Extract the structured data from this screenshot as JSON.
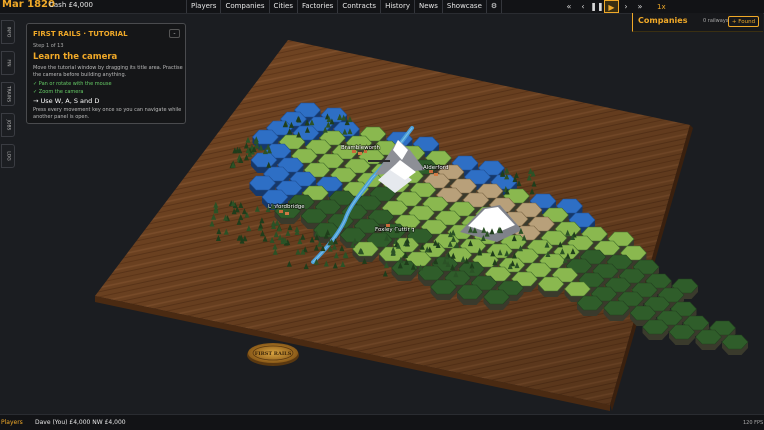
{
  "topbar": {
    "date": "Mar 1820",
    "cash": "Cash £4,000",
    "menu": [
      "Players",
      "Companies",
      "Cities",
      "Factories",
      "Contracts",
      "History",
      "News",
      "Showcase"
    ],
    "settings_icon": "gear-icon",
    "time_controls": [
      "rewind-fast-icon",
      "rewind-icon",
      "pause-icon",
      "play-icon",
      "forward-icon",
      "forward-fast-icon"
    ],
    "speed": "1x"
  },
  "companies_panel": {
    "title": "Companies",
    "subtitle": "0 railways",
    "found_button": "+ Found"
  },
  "side_tabs": [
    "INFO",
    "FIN",
    "TRAINS",
    "JOBS",
    "LOG"
  ],
  "tutorial": {
    "title": "FIRST RAILS · TUTORIAL",
    "minimize": "-",
    "step": "Step 1 of 13",
    "heading": "Learn the camera",
    "description": "Move the tutorial window by dragging its title area. Practise the camera before building anything.",
    "completed": [
      "✓ Pan or rotate with the mouse",
      "✓ Zoom the camera"
    ],
    "current": "→ Use W, A, S and D",
    "note": "Press every movement key once so you can navigate while another panel is open."
  },
  "map": {
    "cities": [
      "Brambleworth",
      "Alderford",
      "Linfordbridge",
      "Foxley Cutting"
    ],
    "seal_text": "FIRST RAILS",
    "colors": {
      "wood": "#7a4a25",
      "water": "#2e6fc5",
      "grass": "#8ab84f",
      "forest": "#2f5d2a",
      "sand": "#b8a07a",
      "river": "#4a9ed8"
    }
  },
  "bottombar": {
    "players_label": "Players",
    "player_info": "Dave (You)  £4,000   NW £4,000",
    "fps": "120 FPS"
  }
}
